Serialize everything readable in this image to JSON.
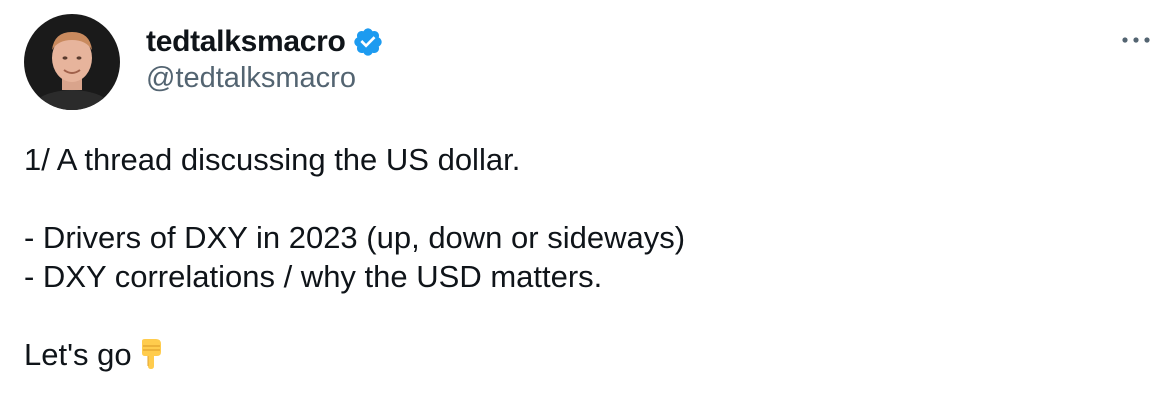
{
  "author": {
    "display_name": "tedtalksmacro",
    "handle": "@tedtalksmacro",
    "verified_icon": "verified-badge-icon",
    "verified_color": "#1d9bf0"
  },
  "more_icon": "more-dots-icon",
  "tweet": {
    "lines": [
      "1/ A thread discussing the US dollar.",
      "",
      "- Drivers of DXY in 2023 (up, down or sideways)",
      "- DXY correlations / why the USD matters.",
      "",
      "Let's go"
    ],
    "trailing_emoji": "backhand-index-pointing-down-icon"
  },
  "colors": {
    "text": "#0f1419",
    "secondary_text": "#536471"
  }
}
